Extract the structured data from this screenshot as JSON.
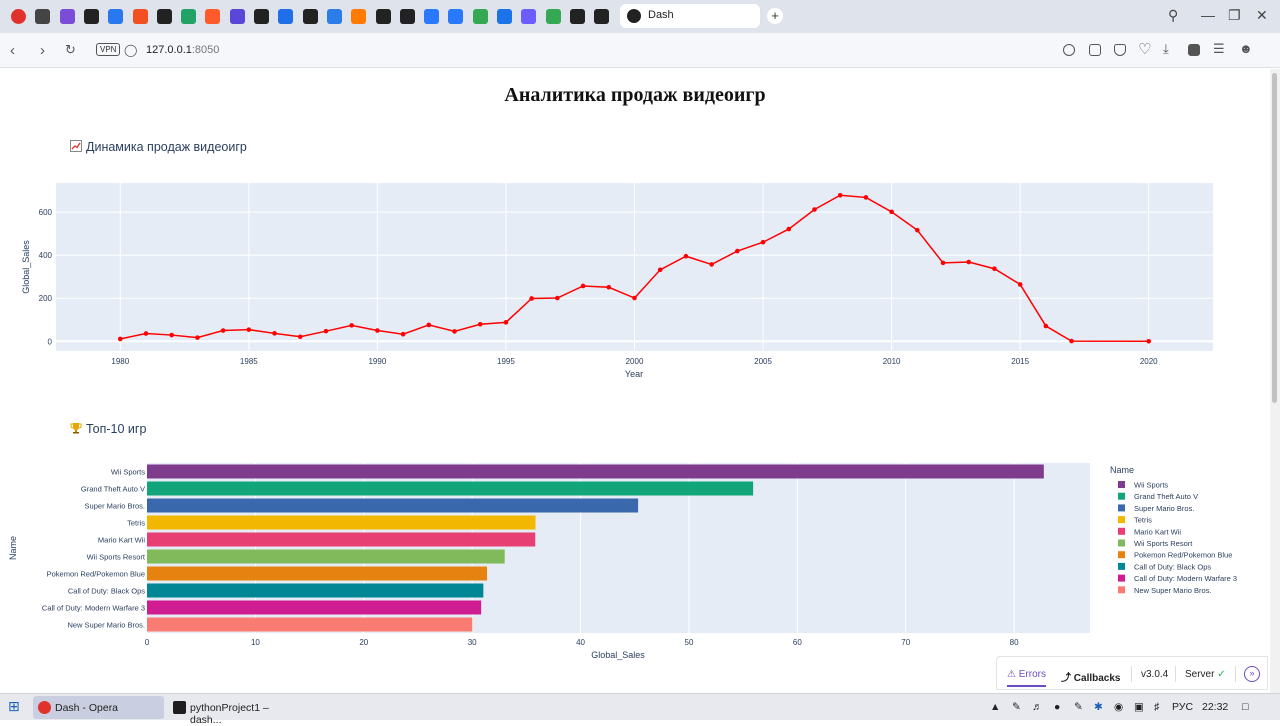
{
  "browser": {
    "active_tab_title": "Dash",
    "new_tab_symbol": "+",
    "vpn_badge": "VPN",
    "url_host": "127.0.0.1",
    "url_port": ":8050",
    "bookmark_colors": [
      "#e0322b",
      "#444",
      "#7b4cd8",
      "#222",
      "#2878f0",
      "#f25022",
      "#222",
      "#21a366",
      "#ff5a2c",
      "#5a46d8",
      "#222",
      "#1f6fe8",
      "#222",
      "#2b7de9",
      "#ff7a00",
      "#222",
      "#222",
      "#2979ff",
      "#2979ff",
      "#34a853",
      "#1a73e8",
      "#6b5cff",
      "#34a853",
      "#222",
      "#222"
    ]
  },
  "page": {
    "title": "Аналитика продаж видеоигр",
    "section1": "Динамика продаж видеоигр",
    "section2": "Топ-10 игр"
  },
  "chart_data": [
    {
      "type": "line",
      "title": "",
      "xlabel": "Year",
      "ylabel": "Global_Sales",
      "xlim": [
        1977.5,
        2022.5
      ],
      "ylim": [
        -45,
        735
      ],
      "x_ticks": [
        1980,
        1985,
        1990,
        1995,
        2000,
        2005,
        2010,
        2015,
        2020
      ],
      "y_ticks": [
        0,
        200,
        400,
        600
      ],
      "color": "#ff0000",
      "x": [
        1980,
        1981,
        1982,
        1983,
        1984,
        1985,
        1986,
        1987,
        1988,
        1989,
        1990,
        1991,
        1992,
        1993,
        1994,
        1995,
        1996,
        1997,
        1998,
        1999,
        2000,
        2001,
        2002,
        2003,
        2004,
        2005,
        2006,
        2007,
        2008,
        2009,
        2010,
        2011,
        2012,
        2013,
        2014,
        2015,
        2016,
        2017,
        2020
      ],
      "y": [
        11,
        36,
        29,
        17,
        50,
        54,
        37,
        21,
        47,
        74,
        50,
        33,
        76,
        46,
        79,
        88,
        199,
        201,
        257,
        251,
        201,
        332,
        395,
        357,
        419,
        460,
        521,
        612,
        678,
        668,
        601,
        516,
        364,
        368,
        337,
        264,
        71,
        1,
        0
      ],
      "grid": true
    },
    {
      "type": "bar",
      "orientation": "horizontal",
      "xlabel": "Global_Sales",
      "ylabel": "Name",
      "xlim": [
        0,
        87
      ],
      "x_ticks": [
        0,
        10,
        20,
        30,
        40,
        50,
        60,
        70,
        80
      ],
      "legend_title": "Name",
      "legend_position": "right",
      "categories": [
        "Wii Sports",
        "Grand Theft Auto V",
        "Super Mario Bros.",
        "Tetris",
        "Mario Kart Wii",
        "Wii Sports Resort",
        "Pokemon Red/Pokemon Blue",
        "Call of Duty: Black Ops",
        "Call of Duty: Modern Warfare 3",
        "New Super Mario Bros."
      ],
      "values": [
        82.74,
        55.92,
        45.31,
        35.84,
        35.82,
        33.0,
        31.37,
        31.03,
        30.83,
        30.01
      ],
      "colors": [
        "#7f3c8d",
        "#11a579",
        "#3969ac",
        "#f2b701",
        "#e73f74",
        "#80ba5a",
        "#e68310",
        "#008695",
        "#cf1c90",
        "#f97b72"
      ],
      "grid": true
    }
  ],
  "devtools": {
    "errors": "Errors",
    "callbacks": "Callbacks",
    "version": "v3.0.4",
    "server": "Server"
  },
  "taskbar": {
    "items": [
      "Dash - Opera",
      "pythonProject1 – dash..."
    ],
    "lang": "РУС",
    "time": "22:32"
  }
}
